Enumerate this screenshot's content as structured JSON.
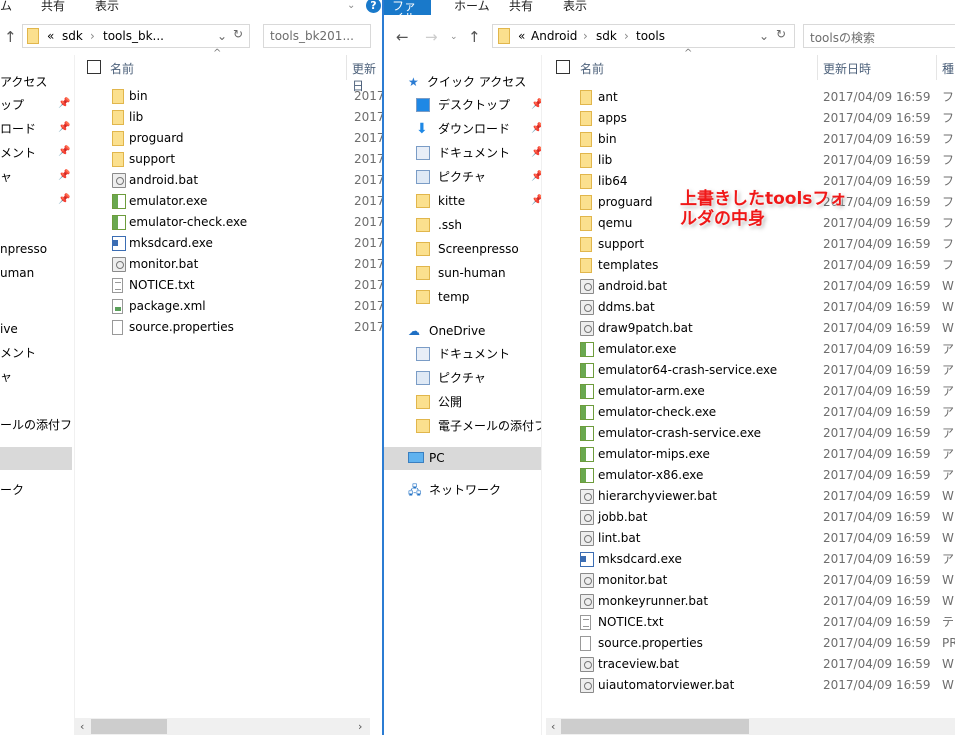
{
  "colors": {
    "accent": "#1979ca",
    "annotation": "#f01818",
    "selected_nav": "#d9d9d9"
  },
  "left_window": {
    "ribbon_tabs": [
      "ム",
      "共有",
      "表示"
    ],
    "help_icon": "question-icon",
    "address": {
      "overflow": "«",
      "crumbs": [
        "sdk",
        "tools_bk..."
      ]
    },
    "search_placeholder": "tools_bk201...",
    "nav_items": [
      "アクセス",
      "ップ",
      "ロード",
      "メント",
      "ャ",
      "",
      "",
      "npresso",
      "uman",
      "",
      "ive",
      "メント",
      "ャ",
      "",
      "ールの添付ファ",
      "",
      "ーク"
    ],
    "columns": {
      "name": "名前",
      "date": "更新日"
    },
    "files": [
      {
        "name": "bin",
        "icon": "folder",
        "date": "2017/"
      },
      {
        "name": "lib",
        "icon": "folder",
        "date": "2017/"
      },
      {
        "name": "proguard",
        "icon": "folder",
        "date": "2017/"
      },
      {
        "name": "support",
        "icon": "folder",
        "date": "2017/"
      },
      {
        "name": "android.bat",
        "icon": "bat",
        "date": "2017/"
      },
      {
        "name": "emulator.exe",
        "icon": "exe",
        "date": "2017/"
      },
      {
        "name": "emulator-check.exe",
        "icon": "exe",
        "date": "2017/"
      },
      {
        "name": "mksdcard.exe",
        "icon": "mk",
        "date": "2017/"
      },
      {
        "name": "monitor.bat",
        "icon": "bat",
        "date": "2017/"
      },
      {
        "name": "NOTICE.txt",
        "icon": "txt",
        "date": "2017/"
      },
      {
        "name": "package.xml",
        "icon": "xml",
        "date": "2017/"
      },
      {
        "name": "source.properties",
        "icon": "doc",
        "date": "2017/"
      }
    ]
  },
  "right_window": {
    "ribbon_tabs": [
      "ファイル",
      "ホーム",
      "共有",
      "表示"
    ],
    "address": {
      "overflow": "«",
      "crumbs": [
        "Android",
        "sdk",
        "tools"
      ]
    },
    "search_placeholder": "toolsの検索",
    "nav": {
      "quick_access": "クイック アクセス",
      "quick_items": [
        {
          "label": "デスクトップ",
          "icon": "desktop-icon",
          "pinned": true
        },
        {
          "label": "ダウンロード",
          "icon": "download-icon",
          "pinned": true
        },
        {
          "label": "ドキュメント",
          "icon": "documents-icon",
          "pinned": true
        },
        {
          "label": "ピクチャ",
          "icon": "pictures-icon",
          "pinned": true
        },
        {
          "label": "kitte",
          "icon": "folder-icon",
          "pinned": true
        },
        {
          "label": ".ssh",
          "icon": "folder-icon",
          "pinned": false
        },
        {
          "label": "Screenpresso",
          "icon": "folder-icon",
          "pinned": false
        },
        {
          "label": "sun-human",
          "icon": "folder-icon",
          "pinned": false
        },
        {
          "label": "temp",
          "icon": "folder-icon",
          "pinned": false
        }
      ],
      "onedrive": "OneDrive",
      "onedrive_items": [
        {
          "label": "ドキュメント",
          "icon": "documents-icon"
        },
        {
          "label": "ピクチャ",
          "icon": "pictures-icon"
        },
        {
          "label": "公開",
          "icon": "folder-icon"
        },
        {
          "label": "電子メールの添付ファ",
          "icon": "folder-icon"
        }
      ],
      "pc": "PC",
      "network": "ネットワーク"
    },
    "columns": {
      "name": "名前",
      "date": "更新日時",
      "type": "種"
    },
    "files": [
      {
        "name": "ant",
        "icon": "folder",
        "date": "2017/04/09 16:59",
        "type": "ファ"
      },
      {
        "name": "apps",
        "icon": "folder",
        "date": "2017/04/09 16:59",
        "type": "ファ"
      },
      {
        "name": "bin",
        "icon": "folder",
        "date": "2017/04/09 16:59",
        "type": "ファ"
      },
      {
        "name": "lib",
        "icon": "folder",
        "date": "2017/04/09 16:59",
        "type": "ファ"
      },
      {
        "name": "lib64",
        "icon": "folder",
        "date": "2017/04/09 16:59",
        "type": "ファ"
      },
      {
        "name": "proguard",
        "icon": "folder",
        "date": "2017/04/09 16:59",
        "type": "ファ"
      },
      {
        "name": "qemu",
        "icon": "folder",
        "date": "2017/04/09 16:59",
        "type": "ファ"
      },
      {
        "name": "support",
        "icon": "folder",
        "date": "2017/04/09 16:59",
        "type": "ファ"
      },
      {
        "name": "templates",
        "icon": "folder",
        "date": "2017/04/09 16:59",
        "type": "ファ"
      },
      {
        "name": "android.bat",
        "icon": "bat",
        "date": "2017/04/09 16:59",
        "type": "W"
      },
      {
        "name": "ddms.bat",
        "icon": "bat",
        "date": "2017/04/09 16:59",
        "type": "W"
      },
      {
        "name": "draw9patch.bat",
        "icon": "bat",
        "date": "2017/04/09 16:59",
        "type": "W"
      },
      {
        "name": "emulator.exe",
        "icon": "exe",
        "date": "2017/04/09 16:59",
        "type": "アプ"
      },
      {
        "name": "emulator64-crash-service.exe",
        "icon": "exe",
        "date": "2017/04/09 16:59",
        "type": "アプ"
      },
      {
        "name": "emulator-arm.exe",
        "icon": "exe",
        "date": "2017/04/09 16:59",
        "type": "アプ"
      },
      {
        "name": "emulator-check.exe",
        "icon": "exe",
        "date": "2017/04/09 16:59",
        "type": "アプ"
      },
      {
        "name": "emulator-crash-service.exe",
        "icon": "exe",
        "date": "2017/04/09 16:59",
        "type": "アプ"
      },
      {
        "name": "emulator-mips.exe",
        "icon": "exe",
        "date": "2017/04/09 16:59",
        "type": "アプ"
      },
      {
        "name": "emulator-x86.exe",
        "icon": "exe",
        "date": "2017/04/09 16:59",
        "type": "アプ"
      },
      {
        "name": "hierarchyviewer.bat",
        "icon": "bat",
        "date": "2017/04/09 16:59",
        "type": "W"
      },
      {
        "name": "jobb.bat",
        "icon": "bat",
        "date": "2017/04/09 16:59",
        "type": "W"
      },
      {
        "name": "lint.bat",
        "icon": "bat",
        "date": "2017/04/09 16:59",
        "type": "W"
      },
      {
        "name": "mksdcard.exe",
        "icon": "mk",
        "date": "2017/04/09 16:59",
        "type": "アプ"
      },
      {
        "name": "monitor.bat",
        "icon": "bat",
        "date": "2017/04/09 16:59",
        "type": "W"
      },
      {
        "name": "monkeyrunner.bat",
        "icon": "bat",
        "date": "2017/04/09 16:59",
        "type": "W"
      },
      {
        "name": "NOTICE.txt",
        "icon": "txt",
        "date": "2017/04/09 16:59",
        "type": "テキ"
      },
      {
        "name": "source.properties",
        "icon": "doc",
        "date": "2017/04/09 16:59",
        "type": "PR"
      },
      {
        "name": "traceview.bat",
        "icon": "bat",
        "date": "2017/04/09 16:59",
        "type": "W"
      },
      {
        "name": "uiautomatorviewer.bat",
        "icon": "bat",
        "date": "2017/04/09 16:59",
        "type": "W"
      }
    ]
  },
  "annotation": {
    "line1": "上書きしたtoolsフォ",
    "line2": "ルダの中身"
  }
}
